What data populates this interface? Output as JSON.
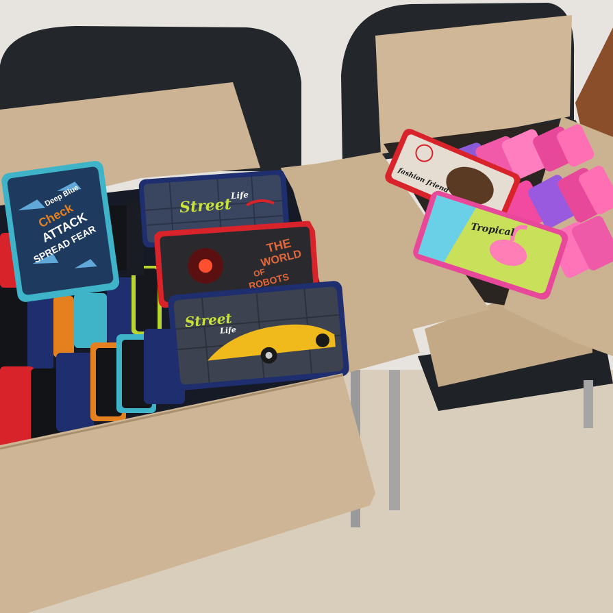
{
  "photo": {
    "left_box": {
      "cases": {
        "sharks": {
          "words": [
            "Check",
            "Deep Blue",
            "ATTACK",
            "SPREAD FEAR"
          ]
        },
        "street_life_top": {
          "title": "Street",
          "subtitle": "Life"
        },
        "world_of_robots": {
          "words": [
            "THE",
            "WORLD",
            "OF",
            "ROBOTS"
          ]
        },
        "street_life_car": {
          "title": "Street",
          "subtitle": "Life"
        }
      }
    },
    "right_box": {
      "cases": {
        "puppy": {
          "caption": "fashion friend"
        },
        "flamingo": {
          "word": "Tropical"
        }
      }
    },
    "colors": {
      "wall": "#e6e3de",
      "floor": "#d8cdbb",
      "cardboard": "#cdb595",
      "cardboard_dark": "#a88f6d",
      "chair": "#24272c",
      "case_navy": "#1e2e6e",
      "case_red": "#d8232a",
      "case_teal": "#3fb4c8",
      "case_pink": "#e8489a",
      "case_orange": "#e5801e",
      "case_lime": "#b9d531"
    }
  }
}
